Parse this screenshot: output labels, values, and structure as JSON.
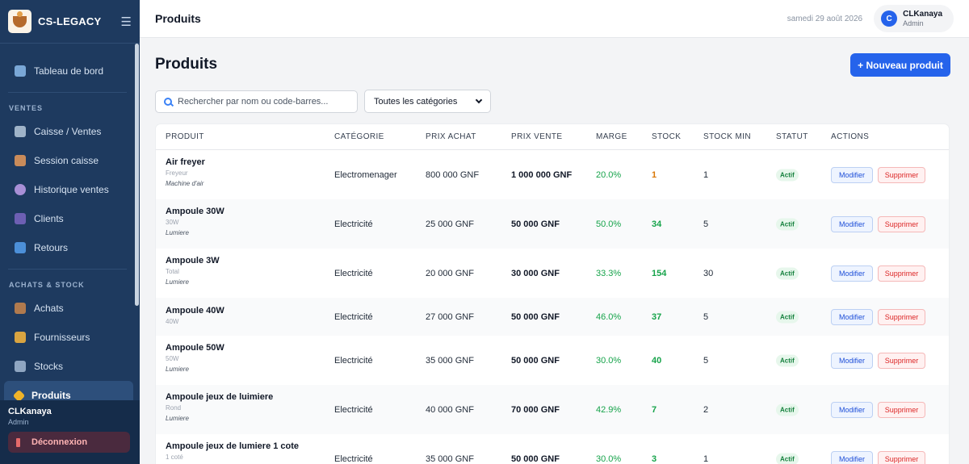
{
  "app": {
    "name": "CS-LEGACY"
  },
  "sidebar": {
    "dashboard": "Tableau de bord",
    "section_sales": "VENTES",
    "sales_items": [
      "Caisse / Ventes",
      "Session caisse",
      "Historique ventes",
      "Clients",
      "Retours"
    ],
    "section_stock": "ACHATS & STOCK",
    "stock_items": [
      "Achats",
      "Fournisseurs",
      "Stocks",
      "Produits"
    ],
    "active": "Produits",
    "footer_user": "CLKanaya",
    "footer_role": "Admin",
    "logout": "Déconnexion"
  },
  "topbar": {
    "title": "Produits",
    "date": "samedi 29 août 2026",
    "avatar_initial": "C",
    "user_name": "CLKanaya",
    "user_role": "Admin"
  },
  "main": {
    "title": "Produits",
    "new_button": "+ Nouveau produit",
    "search_placeholder": "Rechercher par nom ou code-barres...",
    "category_selected": "Toutes les catégories"
  },
  "table": {
    "headers": [
      "PRODUIT",
      "CATÉGORIE",
      "PRIX ACHAT",
      "PRIX VENTE",
      "MARGE",
      "STOCK",
      "STOCK MIN",
      "STATUT",
      "ACTIONS"
    ],
    "edit_label": "Modifier",
    "delete_label": "Supprimer",
    "rows": [
      {
        "name": "Air freyer",
        "sub": "Freyeur",
        "type": "Machine d'air",
        "category": "Electromenager",
        "buy": "800 000 GNF",
        "sell": "1 000 000 GNF",
        "margin": "20.0%",
        "stock": "1",
        "stock_min": "1",
        "status": "Actif"
      },
      {
        "name": "Ampoule 30W",
        "sub": "30W",
        "type": "Lumiere",
        "category": "Electricité",
        "buy": "25 000 GNF",
        "sell": "50 000 GNF",
        "margin": "50.0%",
        "stock": "34",
        "stock_min": "5",
        "status": "Actif"
      },
      {
        "name": "Ampoule 3W",
        "sub": "Total",
        "type": "Lumiere",
        "category": "Electricité",
        "buy": "20 000 GNF",
        "sell": "30 000 GNF",
        "margin": "33.3%",
        "stock": "154",
        "stock_min": "30",
        "status": "Actif"
      },
      {
        "name": "Ampoule 40W",
        "sub": "40W",
        "type": "",
        "category": "Electricité",
        "buy": "27 000 GNF",
        "sell": "50 000 GNF",
        "margin": "46.0%",
        "stock": "37",
        "stock_min": "5",
        "status": "Actif"
      },
      {
        "name": "Ampoule 50W",
        "sub": "50W",
        "type": "Lumiere",
        "category": "Electricité",
        "buy": "35 000 GNF",
        "sell": "50 000 GNF",
        "margin": "30.0%",
        "stock": "40",
        "stock_min": "5",
        "status": "Actif"
      },
      {
        "name": "Ampoule jeux de luimiere",
        "sub": "Rond",
        "type": "Lumiere",
        "category": "Electricité",
        "buy": "40 000 GNF",
        "sell": "70 000 GNF",
        "margin": "42.9%",
        "stock": "7",
        "stock_min": "2",
        "status": "Actif"
      },
      {
        "name": "Ampoule jeux de lumiere 1 cote",
        "sub": "1 coté",
        "type": "",
        "category": "Electricité",
        "buy": "35 000 GNF",
        "sell": "50 000 GNF",
        "margin": "30.0%",
        "stock": "3",
        "stock_min": "1",
        "status": "Actif"
      }
    ]
  },
  "colors": {
    "sidebar": "#1e3a5f",
    "accent": "#2563eb",
    "positive": "#16a34a",
    "warning": "#d97706",
    "danger": "#dc2626"
  }
}
